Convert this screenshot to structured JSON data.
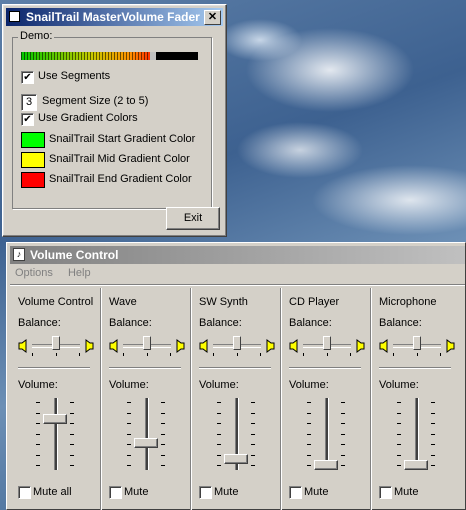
{
  "fader": {
    "title": "SnailTrail MasterVolume Fader",
    "close_glyph": "✕",
    "group_label": "Demo:",
    "meter_level": 0.73,
    "use_segments": {
      "checked": true,
      "label": "Use Segments"
    },
    "segment_size": {
      "value": "3",
      "label": "Segment Size (2 to 5)"
    },
    "use_gradient": {
      "checked": true,
      "label": "Use Gradient Colors"
    },
    "colors": [
      {
        "label": "SnailTrail Start Gradient Color",
        "color": "#00ff00"
      },
      {
        "label": "SnailTrail Mid Gradient Color",
        "color": "#ffff00"
      },
      {
        "label": "SnailTrail End Gradient Color",
        "color": "#ff0000"
      }
    ],
    "exit_label": "Exit"
  },
  "volume": {
    "title": "Volume Control",
    "menu": [
      "Options",
      "Help"
    ],
    "balance_label": "Balance:",
    "volume_label": "Volume:",
    "channels": [
      {
        "name": "Volume Control",
        "mute_label": "Mute all",
        "volume_level": 0.75,
        "muted": false
      },
      {
        "name": "Wave",
        "mute_label": "Mute",
        "volume_level": 0.35,
        "muted": false
      },
      {
        "name": "SW Synth",
        "mute_label": "Mute",
        "volume_level": 0.1,
        "muted": false
      },
      {
        "name": "CD Player",
        "mute_label": "Mute",
        "volume_level": 0.0,
        "muted": false
      },
      {
        "name": "Microphone",
        "mute_label": "Mute",
        "volume_level": 0.0,
        "muted": false
      }
    ]
  }
}
